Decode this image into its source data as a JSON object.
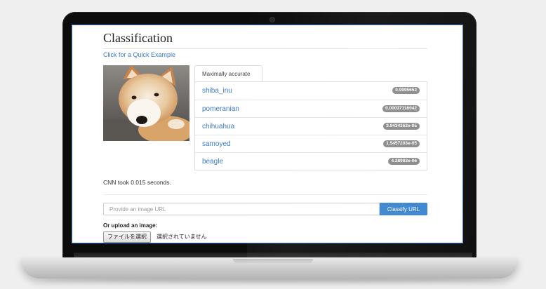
{
  "page": {
    "title": "Classification",
    "quick_example_link": "Click for a Quick Example"
  },
  "results": {
    "tab_label": "Maximally accurate",
    "items": [
      {
        "label": "shiba_inu",
        "score": "0.9995652"
      },
      {
        "label": "pomeranian",
        "score": "0.00037116042"
      },
      {
        "label": "chihuahua",
        "score": "3.9434362e-05"
      },
      {
        "label": "samoyed",
        "score": "1.5457203e-05"
      },
      {
        "label": "beagle",
        "score": "4.28983e-06"
      }
    ]
  },
  "timing_text": "CNN took 0.015 seconds.",
  "url_form": {
    "placeholder": "Provide an image URL",
    "button_label": "Classify URL"
  },
  "upload": {
    "label": "Or upload an image:",
    "file_button_label": "ファイルを選択",
    "file_status": "選択されていません"
  },
  "colors": {
    "link": "#3a7bc8",
    "button": "#3a85d0",
    "badge": "#8a8a8a"
  }
}
